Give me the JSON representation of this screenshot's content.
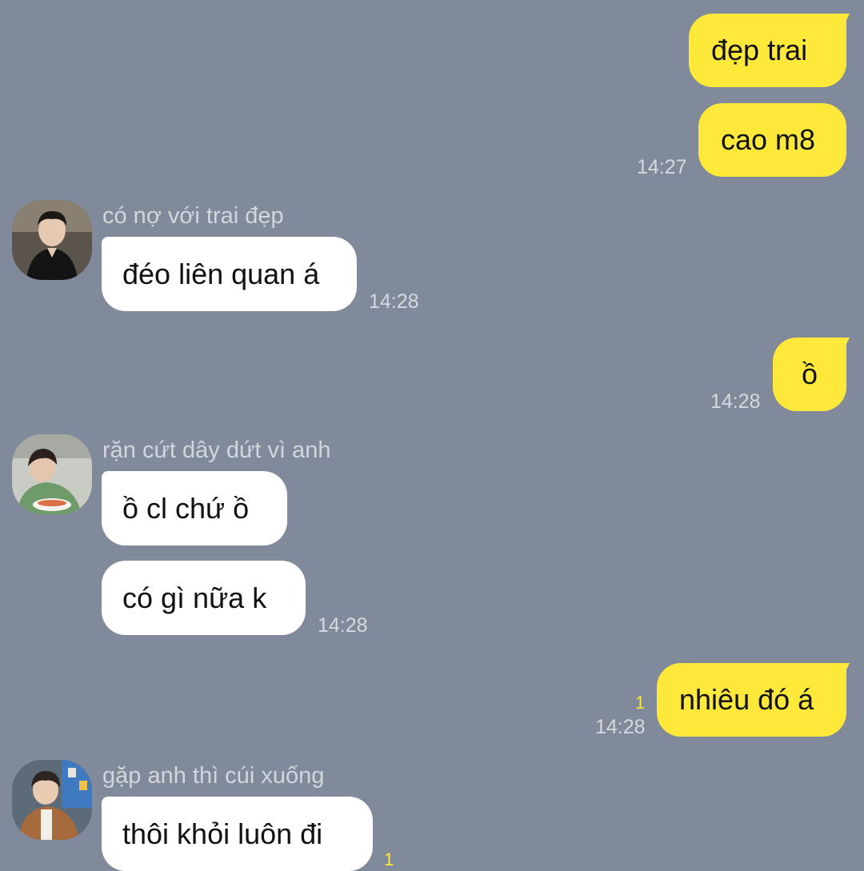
{
  "colors": {
    "background": "#818a9a",
    "outgoing_bubble": "#fee93a",
    "incoming_bubble": "#ffffff",
    "timestamp": "#d6d9df",
    "unread_count": "#fee93a"
  },
  "messages": [
    {
      "direction": "out",
      "text": "đẹp trai"
    },
    {
      "direction": "out",
      "text": "cao m8",
      "time": "14:27"
    },
    {
      "direction": "in",
      "sender": "có nợ với trai đẹp",
      "text": "đéo liên quan á",
      "time": "14:28",
      "avatar_icon": "avatar-photo-icon"
    },
    {
      "direction": "out",
      "text": "ồ",
      "time": "14:28"
    },
    {
      "direction": "in",
      "sender": "rặn cứt dây dứt vì anh",
      "text": "ồ cl chứ ồ",
      "avatar_icon": "avatar-photo-icon"
    },
    {
      "direction": "in",
      "text": "có gì nữa k",
      "time": "14:28"
    },
    {
      "direction": "out",
      "text": "nhiêu đó á",
      "time": "14:28",
      "unread": "1"
    },
    {
      "direction": "in",
      "sender": "gặp anh thì cúi xuống",
      "text": "thôi khỏi luôn đi",
      "unread": "1",
      "avatar_icon": "avatar-photo-icon"
    }
  ]
}
